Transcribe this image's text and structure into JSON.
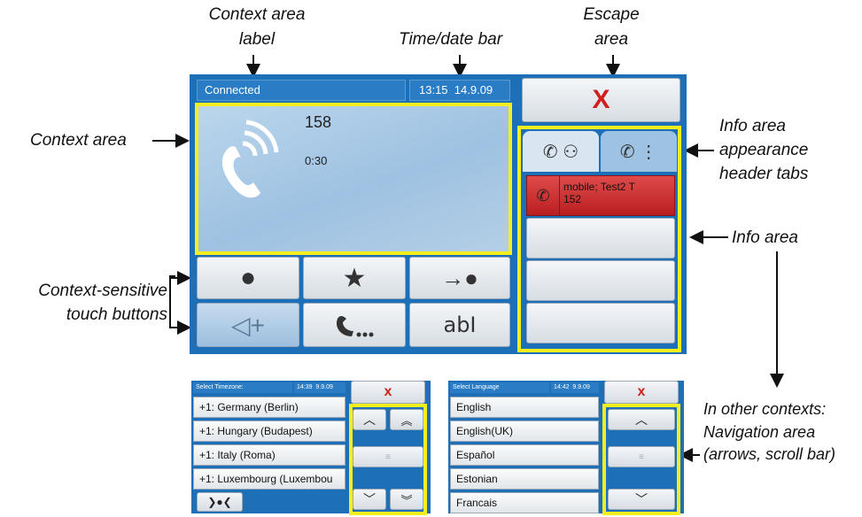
{
  "annotations": {
    "context_area_label": [
      "Context area",
      "label"
    ],
    "time_date_bar": "Time/date bar",
    "escape_area": [
      "Escape",
      "area"
    ],
    "context_area": "Context area",
    "info_area_tabs": [
      "Info area",
      "appearance",
      "header tabs"
    ],
    "info_area": "Info area",
    "touch_buttons": [
      "Context-sensitive",
      "touch buttons"
    ],
    "other_contexts": [
      "In other contexts:",
      "Navigation area",
      "(arrows, scroll bar)"
    ]
  },
  "main_screen": {
    "status_label": "Connected",
    "time": "13:15",
    "date": "14.9.09",
    "escape_symbol": "X",
    "call_number": "158",
    "call_duration": "0:30",
    "info_entry_line1": "mobile; Test2 T",
    "info_entry_line2": "152",
    "buttons": [
      "●",
      "★",
      "→●",
      "◁+",
      "",
      "abI"
    ]
  },
  "timezone_screen": {
    "title": "Select Timezone:",
    "time": "14:39",
    "date": "9.9.09",
    "escape_symbol": "x",
    "items": [
      "+1: Germany (Berlin)",
      "+1: Hungary (Budapest)",
      "+1: Italy (Roma)",
      "+1: Luxembourg (Luxembou"
    ],
    "bottom_button": "❯●❮"
  },
  "language_screen": {
    "title": "Select Language",
    "time": "14:42",
    "date": "9.9.09",
    "escape_symbol": "x",
    "items": [
      "English",
      "English(UK)",
      "Español",
      "Estonian",
      "Francais"
    ]
  },
  "colors": {
    "highlight": "#f4ee1e",
    "screen_blue": "#1d6fb8",
    "escape_red": "#d0201e",
    "entry_red": "#c4282a"
  }
}
